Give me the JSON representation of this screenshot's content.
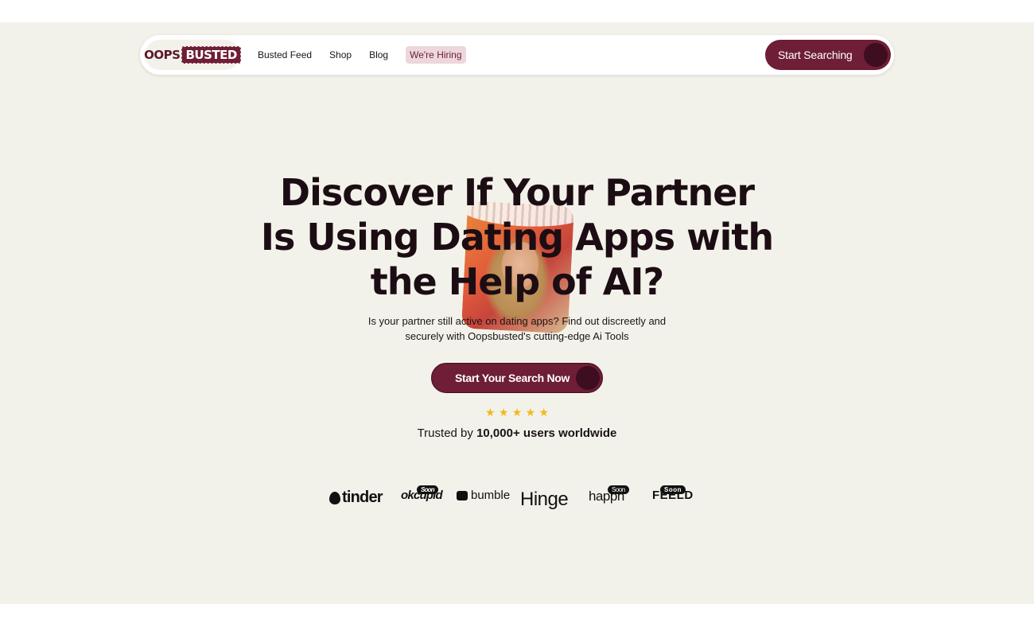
{
  "nav": {
    "logo_part1": "OOPS",
    "logo_part2": "BUSTED",
    "links": [
      "Busted Feed",
      "Shop",
      "Blog"
    ],
    "hiring": "We're Hiring",
    "cta": "Start Searching"
  },
  "hero": {
    "headline_lines": [
      "Discover If Your Partner",
      "Is Using Dating Apps with",
      "the Help of AI?"
    ],
    "subtext_line1": "Is your partner still active on dating apps? Find out discreetly and",
    "subtext_line2": "securely with Oopsbusted's cutting-edge  Ai Tools",
    "cta": "Start Your Search Now",
    "rating_stars": 5,
    "trusted_prefix": "Trusted by",
    "trusted_bold": "10,000+ users worldwide"
  },
  "apps": [
    {
      "name": "tinder",
      "soon": ""
    },
    {
      "name": "okcupid",
      "soon": "Soon"
    },
    {
      "name": "bumble",
      "soon": ""
    },
    {
      "name": "Hinge",
      "soon": ""
    },
    {
      "name": "happn",
      "soon": "Soon"
    },
    {
      "name": "FEELD",
      "soon": "Soon"
    }
  ],
  "colors": {
    "brand": "#6e1e36",
    "brand_dark": "#3e0d1f",
    "background": "#f3f2ea",
    "star": "#f2b81b"
  }
}
